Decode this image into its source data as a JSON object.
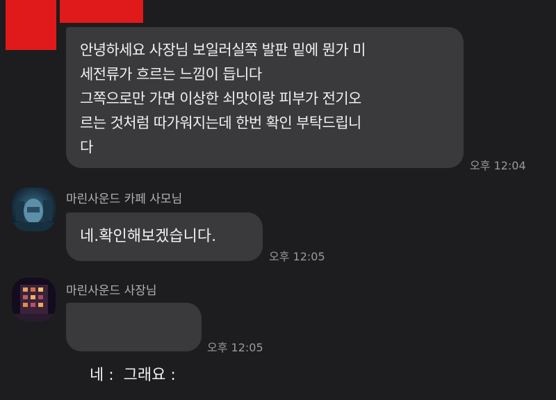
{
  "messages": [
    {
      "lines": [
        "안녕하세요 사장님 보일러실쪽 발판 밑에 뭔가 미",
        "세전류가 흐르는 느낌이 듭니다",
        "그쪽으로만 가면 이상한 쇠맛이랑 피부가 전기오",
        "르는 것처럼 따가워지는데 한번 확인 부탁드립니",
        "다"
      ],
      "time": "오후 12:04"
    },
    {
      "sender": "마린사운드 카페 사모님",
      "text": "네.확인해보겠습니다.",
      "time": "오후 12:05"
    },
    {
      "sender": "마린사운드 사장님",
      "text": "네 :  그래요 :",
      "time": "오후 12:05"
    }
  ],
  "colors": {
    "background": "#1d1d1f",
    "bubble": "#3a3a3c",
    "redaction": "#e0191a"
  }
}
